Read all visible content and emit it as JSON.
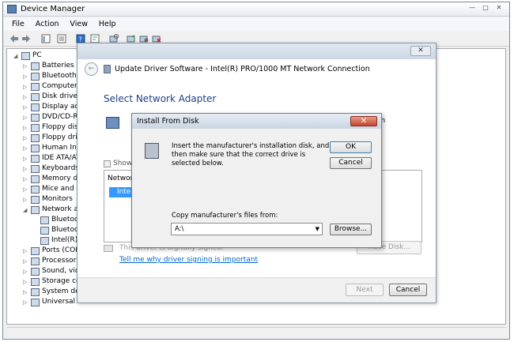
{
  "device_manager": {
    "title": "Device Manager",
    "window_buttons": [
      "—",
      "□",
      "✕"
    ],
    "menu": [
      "File",
      "Action",
      "View",
      "Help"
    ],
    "tree": [
      {
        "label": "PC",
        "expander": "◢",
        "indent": 0
      },
      {
        "label": "Batteries",
        "expander": "▷",
        "indent": 1
      },
      {
        "label": "Bluetooth R",
        "expander": "▷",
        "indent": 1
      },
      {
        "label": "Computer",
        "expander": "▷",
        "indent": 1
      },
      {
        "label": "Disk drives",
        "expander": "▷",
        "indent": 1
      },
      {
        "label": "Display ada",
        "expander": "▷",
        "indent": 1
      },
      {
        "label": "DVD/CD-R",
        "expander": "▷",
        "indent": 1
      },
      {
        "label": "Floppy disk",
        "expander": "▷",
        "indent": 1
      },
      {
        "label": "Floppy driv",
        "expander": "▷",
        "indent": 1
      },
      {
        "label": "Human Int",
        "expander": "▷",
        "indent": 1
      },
      {
        "label": "IDE ATA/AT",
        "expander": "▷",
        "indent": 1
      },
      {
        "label": "Keyboards",
        "expander": "▷",
        "indent": 1
      },
      {
        "label": "Memory de",
        "expander": "▷",
        "indent": 1
      },
      {
        "label": "Mice and d",
        "expander": "▷",
        "indent": 1
      },
      {
        "label": "Monitors",
        "expander": "▷",
        "indent": 1
      },
      {
        "label": "Network ac",
        "expander": "◢",
        "indent": 1
      },
      {
        "label": "Bluetoo",
        "expander": "",
        "indent": 2
      },
      {
        "label": "Bluetoo",
        "expander": "",
        "indent": 2
      },
      {
        "label": "Intel(R)",
        "expander": "",
        "indent": 2
      },
      {
        "label": "Ports (COM",
        "expander": "▷",
        "indent": 1
      },
      {
        "label": "Processors",
        "expander": "▷",
        "indent": 1
      },
      {
        "label": "Sound, vide",
        "expander": "▷",
        "indent": 1
      },
      {
        "label": "Storage co",
        "expander": "▷",
        "indent": 1
      },
      {
        "label": "System dev",
        "expander": "▷",
        "indent": 1
      },
      {
        "label": "Universal S",
        "expander": "▷",
        "indent": 1
      }
    ]
  },
  "update_driver": {
    "title": "Update Driver Software - Intel(R) PRO/1000 MT Network Connection",
    "heading": "Select Network Adapter",
    "instruction_fragment": "en",
    "show_compatible_fragment": "Show",
    "list_header": "Network",
    "list_item": "Intel",
    "signing_text": "This driver is digitally signed.",
    "have_disk_label": "Have Disk...",
    "signing_link": "Tell me why driver signing is important",
    "next_label": "Next",
    "cancel_label": "Cancel",
    "close_glyph": "✕",
    "back_glyph": "←"
  },
  "install_from_disk": {
    "title": "Install From Disk",
    "close_glyph": "✕",
    "message": "Insert the manufacturer's installation disk, and then make sure that the correct drive is selected below.",
    "ok_label": "OK",
    "cancel_label": "Cancel",
    "copy_label": "Copy manufacturer's files from:",
    "path_value": "A:\\",
    "dropdown_glyph": "▼",
    "browse_label": "Browse..."
  }
}
